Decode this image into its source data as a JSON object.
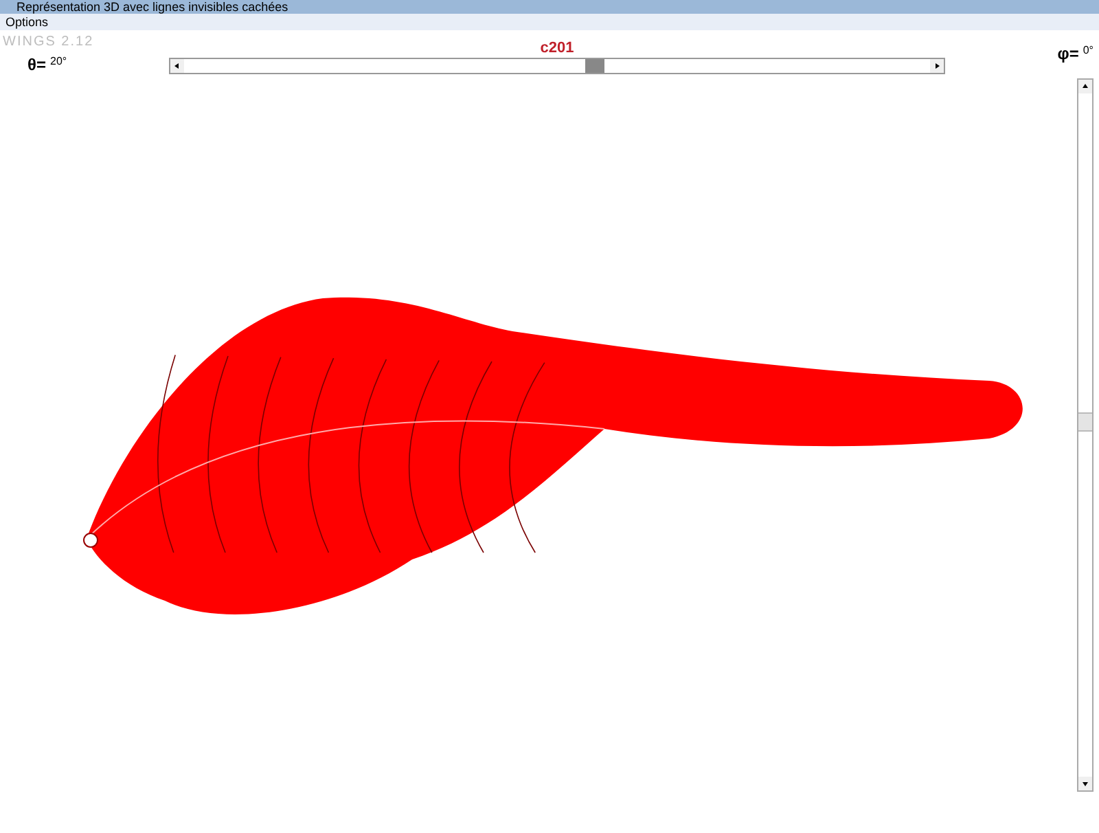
{
  "window": {
    "title": "Représentation 3D avec lignes invisibles cachées"
  },
  "menu": [
    "Options"
  ],
  "app_label": "WINGS 2.12",
  "theta": {
    "symbol": "θ=",
    "value": "20°"
  },
  "phi": {
    "symbol": "φ=",
    "value": "0°"
  },
  "model_name": "c201",
  "horizontal_slider": {
    "level": 0.55
  },
  "vertical_slider": {
    "level": 0.48
  }
}
